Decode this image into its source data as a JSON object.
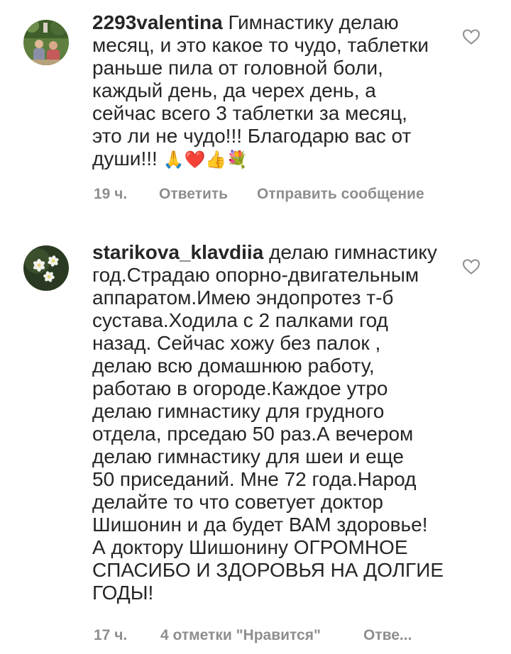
{
  "comments": [
    {
      "username": "2293valentina",
      "lines": [
        "Гимнастику делаю",
        "месяц, и это какое то чудо, таблетки",
        "раньше пила от головной боли,",
        "каждый день, да черех день, а",
        "сейчас всего 3 таблетки за месяц,",
        "это ли не чудо!!! Благодарю вас от",
        "души!!!"
      ],
      "emojis": "🙏❤️👍💐",
      "time": "19 ч.",
      "reply": "Ответить",
      "send_message": "Отправить сообщение",
      "like_icon": "heart-outline-icon"
    },
    {
      "username": "starikova_klavdiia",
      "lines": [
        "делаю гимнастику",
        "год.Страдаю опорно-двигательным",
        "аппаратом.Имею эндопротез т-б",
        "сустава.Ходила с 2 палками год",
        "назад. Сейчас хожу без палок ,",
        " делаю всю домашнюю работу,",
        "работаю в огороде.Каждое утро",
        "делаю гимнастику для грудного",
        "отдела, прседаю 50 раз.А вечером",
        "делаю гимнастику для шеи и еще",
        "50 приседаний. Мне 72 года.Народ",
        "делайте то что советует доктор",
        "Шишонин и да будет ВАМ здоровье!",
        "А доктору Шишонину ОГРОМНОЕ",
        "СПАСИБО И ЗДОРОВЬЯ НА ДОЛГИЕ",
        "ГОДЫ!"
      ],
      "time": "17 ч.",
      "likes": "4 отметки \"Нравится\"",
      "reply_truncated": "Отве...",
      "like_icon": "heart-outline-icon"
    }
  ]
}
